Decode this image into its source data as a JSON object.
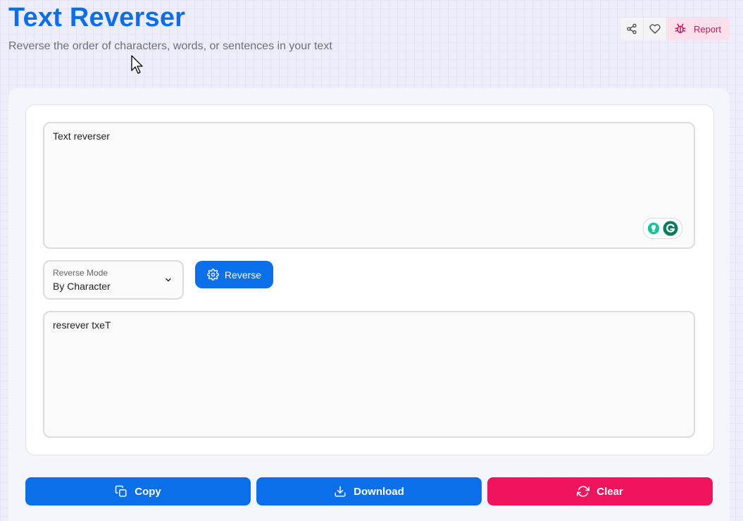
{
  "header": {
    "title": "Text Reverser",
    "subtitle": "Reverse the order of characters, words, or sentences in your text",
    "report_label": "Report"
  },
  "input": {
    "value": "Text reverser"
  },
  "mode": {
    "label": "Reverse Mode",
    "value": "By Character"
  },
  "reverse_button": {
    "label": "Reverse"
  },
  "output": {
    "value": "resrever txeT"
  },
  "actions": {
    "copy_label": "Copy",
    "download_label": "Download",
    "clear_label": "Clear"
  },
  "colors": {
    "primary": "#0a6fe8",
    "danger": "#f0145e",
    "report_bg": "#fbe0ec",
    "report_text": "#c2185b"
  },
  "icons": {
    "share": "share-icon",
    "favorite": "heart-icon",
    "report": "bug-icon",
    "settings": "gear-icon",
    "copy": "copy-icon",
    "download": "download-icon",
    "clear": "refresh-icon",
    "dropdown": "chevron-down-icon"
  }
}
